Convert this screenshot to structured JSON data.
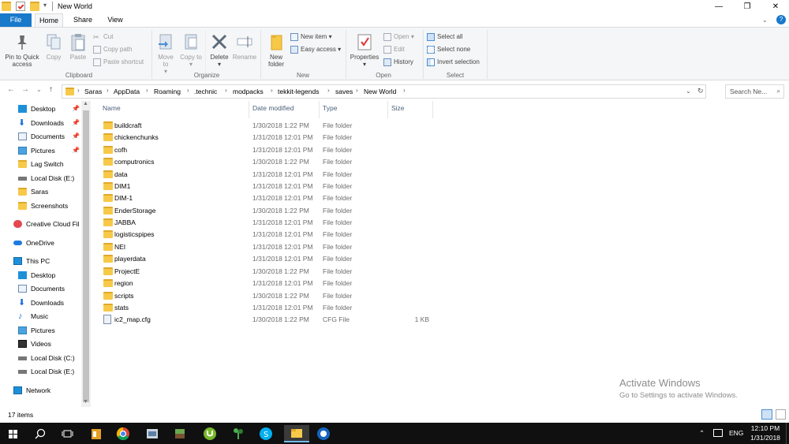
{
  "window": {
    "title": "New World",
    "controls": {
      "minimize": "—",
      "maximize": "❐",
      "close": "✕"
    }
  },
  "ribbon_tabs": [
    "File",
    "Home",
    "Share",
    "View"
  ],
  "ribbon": {
    "clipboard": {
      "label": "Clipboard",
      "pin": "Pin to Quick access",
      "copy": "Copy",
      "paste": "Paste",
      "cut": "Cut",
      "copy_path": "Copy path",
      "paste_shortcut": "Paste shortcut"
    },
    "organize": {
      "label": "Organize",
      "move_to": "Move to",
      "copy_to": "Copy to",
      "delete": "Delete",
      "rename": "Rename"
    },
    "new": {
      "label": "New",
      "new_folder": "New folder",
      "new_item": "New item",
      "easy_access": "Easy access"
    },
    "open": {
      "label": "Open",
      "properties": "Properties",
      "open": "Open",
      "edit": "Edit",
      "history": "History"
    },
    "select": {
      "label": "Select",
      "select_all": "Select all",
      "select_none": "Select none",
      "invert": "Invert selection"
    }
  },
  "address": {
    "crumbs": [
      "Saras",
      "AppData",
      "Roaming",
      ".technic",
      "modpacks",
      "tekkit-legends",
      "saves",
      "New World"
    ],
    "search_placeholder": "Search Ne..."
  },
  "nav_pane": {
    "quick_access": [
      "Desktop",
      "Downloads",
      "Documents",
      "Pictures",
      "Lag Switch",
      "Local Disk (E:)",
      "Saras",
      "Screenshots"
    ],
    "creative_cloud": "Creative Cloud Fil",
    "onedrive": "OneDrive",
    "this_pc": "This PC",
    "this_pc_items": [
      "Desktop",
      "Documents",
      "Downloads",
      "Music",
      "Pictures",
      "Videos",
      "Local Disk (C:)",
      "Local Disk (E:)"
    ],
    "network": "Network"
  },
  "columns": {
    "name": "Name",
    "date": "Date modified",
    "type": "Type",
    "size": "Size"
  },
  "files": [
    {
      "name": "buildcraft",
      "date": "1/30/2018 1:22 PM",
      "type": "File folder",
      "size": ""
    },
    {
      "name": "chickenchunks",
      "date": "1/31/2018 12:01 PM",
      "type": "File folder",
      "size": ""
    },
    {
      "name": "cofh",
      "date": "1/31/2018 12:01 PM",
      "type": "File folder",
      "size": ""
    },
    {
      "name": "computronics",
      "date": "1/30/2018 1:22 PM",
      "type": "File folder",
      "size": ""
    },
    {
      "name": "data",
      "date": "1/31/2018 12:01 PM",
      "type": "File folder",
      "size": ""
    },
    {
      "name": "DIM1",
      "date": "1/31/2018 12:01 PM",
      "type": "File folder",
      "size": ""
    },
    {
      "name": "DIM-1",
      "date": "1/31/2018 12:01 PM",
      "type": "File folder",
      "size": ""
    },
    {
      "name": "EnderStorage",
      "date": "1/30/2018 1:22 PM",
      "type": "File folder",
      "size": ""
    },
    {
      "name": "JABBA",
      "date": "1/31/2018 12:01 PM",
      "type": "File folder",
      "size": ""
    },
    {
      "name": "logisticspipes",
      "date": "1/31/2018 12:01 PM",
      "type": "File folder",
      "size": ""
    },
    {
      "name": "NEI",
      "date": "1/31/2018 12:01 PM",
      "type": "File folder",
      "size": ""
    },
    {
      "name": "playerdata",
      "date": "1/31/2018 12:01 PM",
      "type": "File folder",
      "size": ""
    },
    {
      "name": "ProjectE",
      "date": "1/30/2018 1:22 PM",
      "type": "File folder",
      "size": ""
    },
    {
      "name": "region",
      "date": "1/31/2018 12:01 PM",
      "type": "File folder",
      "size": ""
    },
    {
      "name": "scripts",
      "date": "1/30/2018 1:22 PM",
      "type": "File folder",
      "size": ""
    },
    {
      "name": "stats",
      "date": "1/31/2018 12:01 PM",
      "type": "File folder",
      "size": ""
    },
    {
      "name": "ic2_map.cfg",
      "date": "1/30/2018 1:22 PM",
      "type": "CFG File",
      "size": "1 KB"
    }
  ],
  "watermark": {
    "line1": "Activate Windows",
    "line2": "Go to Settings to activate Windows."
  },
  "status": {
    "count": "17 items"
  },
  "taskbar": {
    "language": "ENG",
    "time": "12:10 PM",
    "date": "1/31/2018"
  },
  "colors": {
    "accent": "#1979ca",
    "folder": "#f7c948",
    "taskbar": "#101010"
  }
}
